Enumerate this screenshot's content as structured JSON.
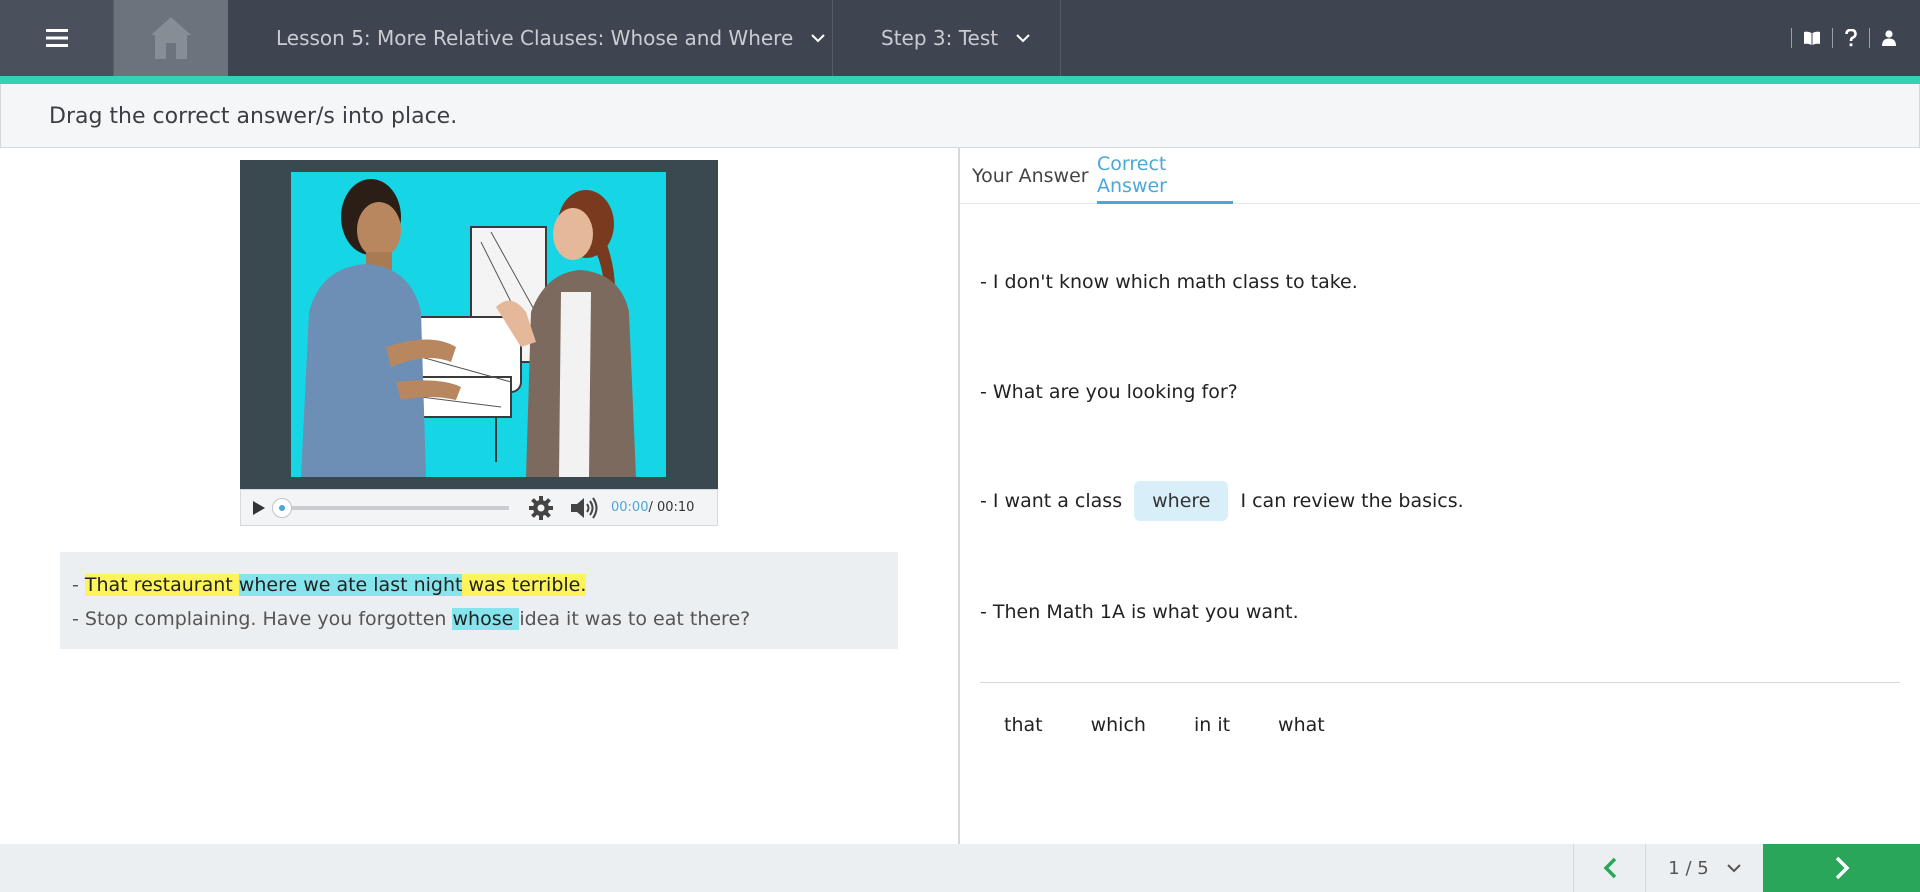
{
  "header": {
    "lesson_title": "Lesson 5: More Relative Clauses: Whose and Where",
    "step_title": "Step 3: Test"
  },
  "instruction": "Drag the correct answer/s into place.",
  "video": {
    "current_time": "00:00",
    "duration": "/ 00:10",
    "progress": 0
  },
  "transcript": {
    "line1": {
      "dash": "- ",
      "part1": "That restaurant ",
      "part2": "where we ate last night",
      "part3": " was terrible."
    },
    "line2": {
      "part1": "- Stop complaining. Have you forgotten ",
      "part2": "whose ",
      "part3": "idea it was to eat there?"
    }
  },
  "tabs": {
    "your_answer": "Your Answer",
    "correct_answer": "Correct Answer",
    "active": "correct_answer"
  },
  "dialogue": {
    "line1": "- I don't know which math class to take.",
    "line2": "- What are you looking for?",
    "line3_before": "- I want a class",
    "line3_answer": "where",
    "line3_after": "I can review the basics.",
    "line4": "- Then Math 1A is what you want."
  },
  "word_bank": [
    "that",
    "which",
    "in it",
    "what"
  ],
  "pagination": {
    "label": "1 / 5"
  },
  "colors": {
    "topbar": "#3f4550",
    "accent": "#34d1b6",
    "highlight_yellow": "#fdf35a",
    "highlight_cyan": "#86e4ec",
    "active_tab": "#4aa8d8",
    "next_button": "#2aa65a"
  },
  "icons": {
    "menu": "hamburger-icon",
    "home": "home-icon",
    "book": "book-icon",
    "help": "question-icon",
    "user": "user-icon",
    "play": "play-icon",
    "settings": "gear-icon",
    "volume": "volume-icon",
    "prev": "chevron-left-icon",
    "next": "chevron-right-icon"
  }
}
